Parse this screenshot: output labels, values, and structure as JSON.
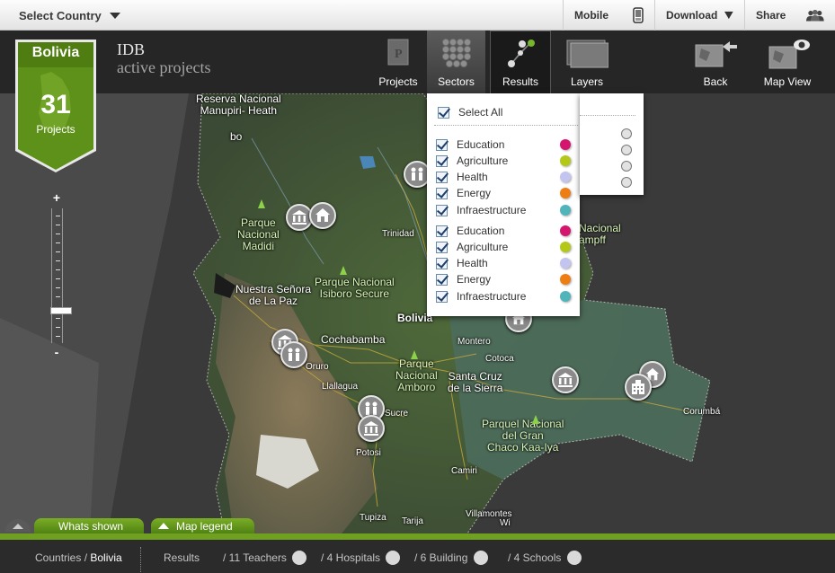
{
  "topbar": {
    "select_country": "Select Country",
    "mobile": "Mobile",
    "download": "Download",
    "share": "Share"
  },
  "header": {
    "title": "IDB",
    "subtitle": "active projects",
    "nav": {
      "projects": "Projects",
      "sectors": "Sectors",
      "results": "Results",
      "layers": "Layers",
      "back": "Back",
      "map_view": "Map View"
    }
  },
  "badge": {
    "country": "Bolivia",
    "count": "31",
    "label": "Projects"
  },
  "zoom": {
    "plus": "+",
    "minus": "-",
    "level": 0.4
  },
  "sectors_panel": {
    "select_all": "Select All",
    "items": [
      {
        "label": "Education",
        "color": "#d5166e"
      },
      {
        "label": "Agriculture",
        "color": "#b5c817"
      },
      {
        "label": "Health",
        "color": "#c4c4f0"
      },
      {
        "label": "Energy",
        "color": "#ee7d14"
      },
      {
        "label": "Infraestructure",
        "color": "#4fb5ba"
      },
      {
        "label": "Education",
        "color": "#d5166e"
      },
      {
        "label": "Agriculture",
        "color": "#b5c817"
      },
      {
        "label": "Health",
        "color": "#c4c4f0"
      },
      {
        "label": "Energy",
        "color": "#ee7d14"
      },
      {
        "label": "Infraestructure",
        "color": "#4fb5ba"
      }
    ]
  },
  "map_labels": {
    "reserva": "Reserva Nacional\nManupiri- Heath",
    "bo": "bo",
    "parque_madidi": "Parque\nNacional\nMadidi",
    "trinidad": "Trinidad",
    "nacional_hampf": "Nacional\nampff",
    "parque_isiboro": "Parque Nacional\nIsiboro Secure",
    "la_paz": "Nuestra Señora\nde La Paz",
    "bolivia": "Bolivia",
    "cochabamba": "Cochabamba",
    "montero": "Montero",
    "cotoca": "Cotoca",
    "parque_amboro": "Parque\nNacional\nAmboro",
    "santa_cruz": "Santa Cruz\nde la Sierra",
    "oruro": "Oruro",
    "llallagua": "Llallagua",
    "sucre": "Sucre",
    "potosi": "Potosi",
    "parque_chaco": "Parquel Nacional\ndel Gran\nChaco Kaa-Iya",
    "corumba": "Corumbá",
    "camiri": "Camiri",
    "tupiza": "Tupiza",
    "tarija": "Tarija",
    "villamontes": "Villamontes",
    "wi": "Wi"
  },
  "bottom_tabs": {
    "whats_shown": "Whats shown",
    "map_legend": "Map legend"
  },
  "status": {
    "countries": "Countries",
    "sep": " / ",
    "country": "Bolivia",
    "results": "Results",
    "teachers": "/ 11 Teachers",
    "hospitals": "/ 4 Hospitals",
    "building": "/ 6 Building",
    "schools": "/ 4 Schools"
  },
  "colors": {
    "brand_green": "#6fa01f",
    "badge_green": "#5e9119"
  }
}
